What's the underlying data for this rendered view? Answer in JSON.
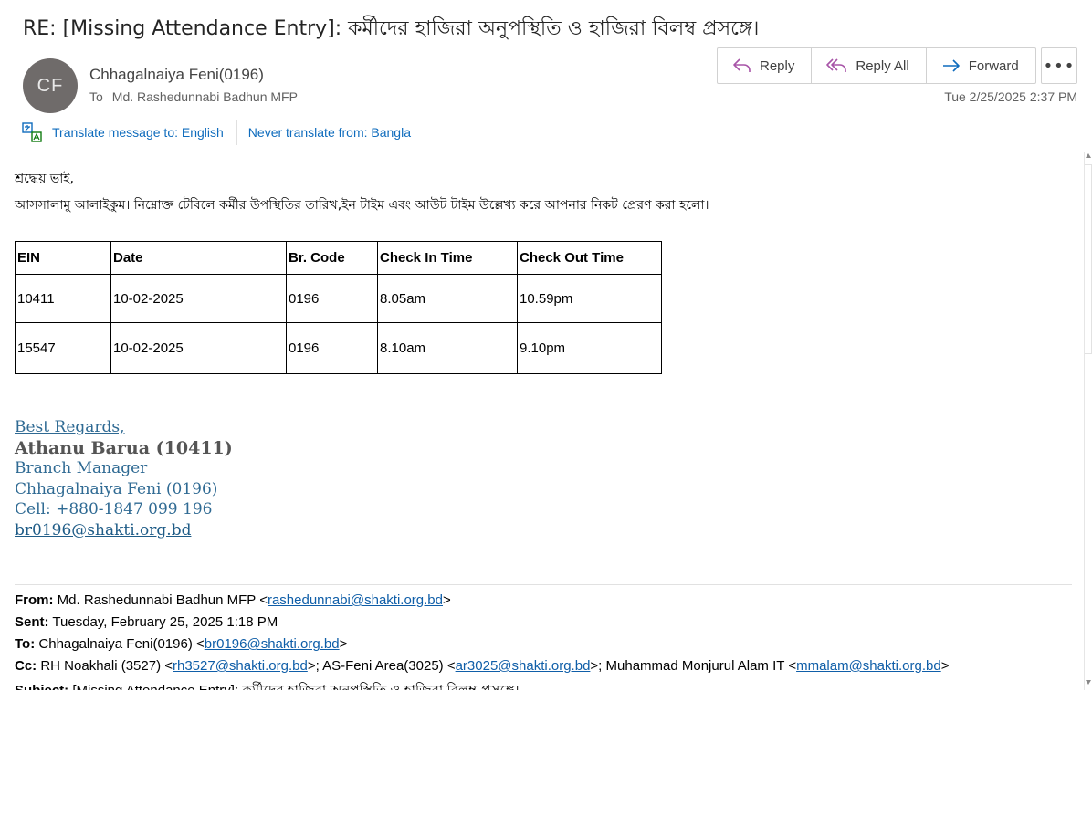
{
  "subject": "RE: [Missing Attendance Entry]: কর্মীদের হাজিরা অনুপস্থিতি ও হাজিরা বিলম্ব প্রসঙ্গে।",
  "sender": {
    "initials": "CF",
    "name": "Chhagalnaiya Feni(0196)",
    "to_label": "To",
    "to": "Md. Rashedunnabi Badhun MFP"
  },
  "actions": {
    "reply": "Reply",
    "reply_all": "Reply All",
    "forward": "Forward",
    "more": "•••"
  },
  "date": "Tue 2/25/2025 2:37 PM",
  "translate": {
    "translate_to": "Translate message to: English",
    "never": "Never translate from: Bangla"
  },
  "body": {
    "greeting": "শ্রদ্ধেয় ভাই,",
    "intro": "আসসালামু আলাইকুম। নিম্নোক্ত টেবিলে কর্মীর উপস্থিতির তারিখ,ইন টাইম এবং আউট টাইম উল্লেখ্য করে আপনার নিকট প্রেরণ করা হলো।",
    "table": {
      "headers": [
        "EIN",
        "Date",
        "Br. Code",
        "Check In Time",
        "Check Out Time"
      ],
      "rows": [
        [
          "10411",
          "10-02-2025",
          "0196",
          "8.05am",
          "10.59pm"
        ],
        [
          "15547",
          "10-02-2025",
          "0196",
          "8.10am",
          "9.10pm"
        ]
      ]
    },
    "signature": {
      "regards": "Best Regards,",
      "name": "Athanu Barua (10411)",
      "title": "Branch Manager",
      "branch": "Chhagalnaiya Feni (0196)",
      "cell": "Cell: +880-1847 099 196",
      "email": "br0196@shakti.org.bd"
    },
    "quoted": {
      "from_label": "From:",
      "from_name": "Md. Rashedunnabi Badhun MFP <",
      "from_email": "rashedunnabi@shakti.org.bd",
      "from_end": ">",
      "sent_label": "Sent:",
      "sent": "Tuesday, February 25, 2025 1:18 PM",
      "to_label": "To:",
      "to_name": "Chhagalnaiya Feni(0196) <",
      "to_email": "br0196@shakti.org.bd",
      "to_end": ">",
      "cc_label": "Cc:",
      "cc1": "RH Noakhali (3527) <",
      "cc1_email": "rh3527@shakti.org.bd",
      "cc2": ">; AS-Feni Area(3025) <",
      "cc2_email": "ar3025@shakti.org.bd",
      "cc3": ">; Muhammad Monjurul Alam IT <",
      "cc3_email": "mmalam@shakti.org.bd",
      "cc_end": ">",
      "subject_label": "Subject:",
      "subject": "[Missing Attendance Entry]: কর্মীদের হাজিরা অনুপস্থিতি ও হাজিরা বিলম্ব প্রসঙ্গে।"
    }
  },
  "colors": {
    "accent": "#0f6cbd",
    "reply_icon": "#a855a8",
    "forward_icon": "#0f6cbd",
    "signature": "#2f6a93"
  }
}
